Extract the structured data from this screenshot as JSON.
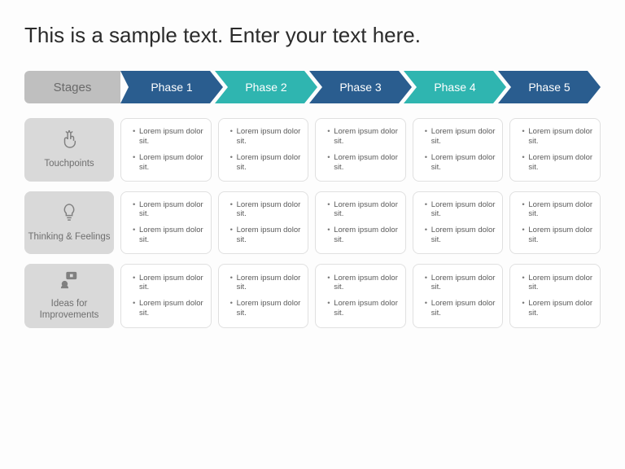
{
  "title": "This is a sample text. Enter your text here.",
  "stages_label": "Stages",
  "phases": [
    {
      "label": "Phase 1",
      "color": "#2a5d8f"
    },
    {
      "label": "Phase 2",
      "color": "#2fb5b0"
    },
    {
      "label": "Phase 3",
      "color": "#2a5d8f"
    },
    {
      "label": "Phase 4",
      "color": "#2fb5b0"
    },
    {
      "label": "Phase 5",
      "color": "#2a5d8f"
    }
  ],
  "rows": [
    {
      "icon": "touch-icon",
      "label": "Touchpoints",
      "cells": [
        [
          "Lorem ipsum dolor sit.",
          "Lorem ipsum dolor sit."
        ],
        [
          "Lorem ipsum dolor sit.",
          "Lorem ipsum dolor sit."
        ],
        [
          "Lorem ipsum dolor sit.",
          "Lorem ipsum dolor sit."
        ],
        [
          "Lorem ipsum dolor sit.",
          "Lorem ipsum dolor sit."
        ],
        [
          "Lorem ipsum dolor sit.",
          "Lorem ipsum dolor sit."
        ]
      ]
    },
    {
      "icon": "bulb-icon",
      "label": "Thinking & Feelings",
      "cells": [
        [
          "Lorem ipsum dolor sit.",
          "Lorem ipsum dolor sit."
        ],
        [
          "Lorem ipsum dolor sit.",
          "Lorem ipsum dolor sit."
        ],
        [
          "Lorem ipsum dolor sit.",
          "Lorem ipsum dolor sit."
        ],
        [
          "Lorem ipsum dolor sit.",
          "Lorem ipsum dolor sit."
        ],
        [
          "Lorem ipsum dolor sit.",
          "Lorem ipsum dolor sit."
        ]
      ]
    },
    {
      "icon": "chat-icon",
      "label": "Ideas for Improvements",
      "cells": [
        [
          "Lorem ipsum dolor sit.",
          "Lorem ipsum dolor sit."
        ],
        [
          "Lorem ipsum dolor sit.",
          "Lorem ipsum dolor sit."
        ],
        [
          "Lorem ipsum dolor sit.",
          "Lorem ipsum dolor sit."
        ],
        [
          "Lorem ipsum dolor sit.",
          "Lorem ipsum dolor sit."
        ],
        [
          "Lorem ipsum dolor sit.",
          "Lorem ipsum dolor sit."
        ]
      ]
    }
  ]
}
